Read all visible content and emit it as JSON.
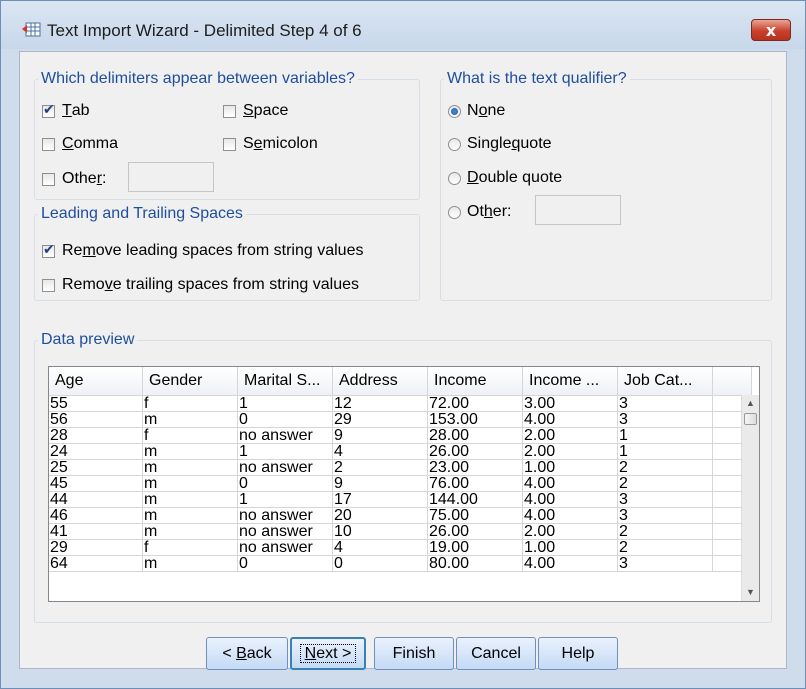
{
  "window": {
    "title": "Text Import Wizard - Delimited Step 4 of 6",
    "close_glyph": "x"
  },
  "delimiters": {
    "legend": "Which delimiters appear between variables?",
    "tab": {
      "pre": "",
      "u": "T",
      "post": "ab",
      "checked": true
    },
    "space": {
      "pre": "",
      "u": "S",
      "post": "pace",
      "checked": false
    },
    "comma": {
      "pre": "",
      "u": "C",
      "post": "omma",
      "checked": false
    },
    "semicolon": {
      "pre": "S",
      "u": "e",
      "post": "micolon",
      "checked": false
    },
    "other": {
      "pre": "Othe",
      "u": "r",
      "post": ":",
      "checked": false,
      "value": ""
    }
  },
  "spaces": {
    "legend": "Leading and Trailing Spaces",
    "leading": {
      "pre": "Re",
      "u": "m",
      "post": "ove leading spaces from string values",
      "checked": true
    },
    "trailing": {
      "pre": "Remo",
      "u": "v",
      "post": "e trailing spaces from string values",
      "checked": false
    }
  },
  "qualifier": {
    "legend": "What is the text qualifier?",
    "none": {
      "pre": "N",
      "u": "o",
      "post": "ne",
      "selected": true
    },
    "single": {
      "pre": "Single ",
      "u": "q",
      "post": "uote",
      "selected": false
    },
    "double": {
      "pre": "",
      "u": "D",
      "post": "ouble quote",
      "selected": false
    },
    "other": {
      "pre": "Ot",
      "u": "h",
      "post": "er:",
      "selected": false,
      "value": ""
    }
  },
  "preview": {
    "legend": "Data preview",
    "columns": [
      "Age",
      "Gender",
      "Marital S...",
      "Address",
      "Income",
      "Income ...",
      "Job Cat..."
    ],
    "rows": [
      [
        "55",
        "f",
        "1",
        "12",
        "72.00",
        "3.00",
        "3"
      ],
      [
        "56",
        "m",
        "0",
        "29",
        "153.00",
        "4.00",
        "3"
      ],
      [
        "28",
        "f",
        "no answer",
        "9",
        "28.00",
        "2.00",
        "1"
      ],
      [
        "24",
        "m",
        "1",
        "4",
        "26.00",
        "2.00",
        "1"
      ],
      [
        "25",
        "m",
        "no answer",
        "2",
        "23.00",
        "1.00",
        "2"
      ],
      [
        "45",
        "m",
        "0",
        "9",
        "76.00",
        "4.00",
        "2"
      ],
      [
        "44",
        "m",
        "1",
        "17",
        "144.00",
        "4.00",
        "3"
      ],
      [
        "46",
        "m",
        "no answer",
        "20",
        "75.00",
        "4.00",
        "3"
      ],
      [
        "41",
        "m",
        "no answer",
        "10",
        "26.00",
        "2.00",
        "2"
      ],
      [
        "29",
        "f",
        "no answer",
        "4",
        "19.00",
        "1.00",
        "2"
      ],
      [
        "64",
        "m",
        "0",
        "0",
        "80.00",
        "4.00",
        "3"
      ]
    ]
  },
  "buttons": {
    "back": {
      "pre": "< ",
      "u": "B",
      "post": "ack"
    },
    "next": {
      "pre": "",
      "u": "N",
      "post": "ext >"
    },
    "finish": "Finish",
    "cancel": "Cancel",
    "help": "Help"
  }
}
